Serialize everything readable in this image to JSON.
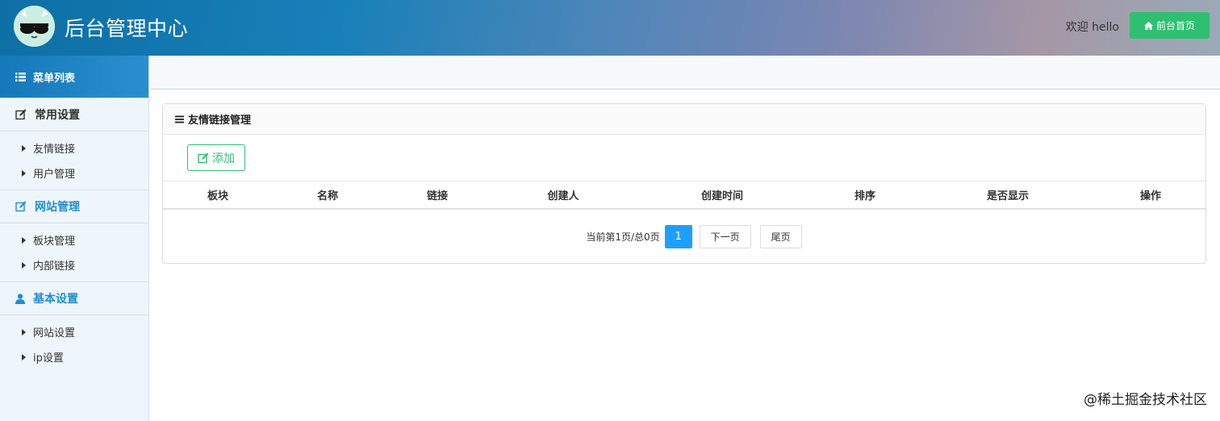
{
  "header": {
    "title": "后台管理中心",
    "welcome": "欢迎 hello",
    "home_button": "前台首页"
  },
  "sidebar": {
    "menu_title": "菜单列表",
    "groups": [
      {
        "title": "常用设置",
        "icon": "edit-icon",
        "items": [
          "友情链接",
          "用户管理"
        ]
      },
      {
        "title": "网站管理",
        "icon": "edit-icon",
        "items": [
          "板块管理",
          "内部链接"
        ]
      },
      {
        "title": "基本设置",
        "icon": "user-icon",
        "items": [
          "网站设置",
          "ip设置"
        ]
      }
    ]
  },
  "panel": {
    "title": "友情链接管理",
    "add_button": "添加",
    "columns": [
      "板块",
      "名称",
      "链接",
      "创建人",
      "创建时间",
      "排序",
      "是否显示",
      "操作"
    ]
  },
  "pagination": {
    "info": "当前第1页/总0页",
    "current": "1",
    "next": "下一页",
    "last": "尾页"
  },
  "watermark": "@稀土掘金技术社区",
  "colors": {
    "accent_green": "#2fbf71",
    "accent_blue": "#1e9fff",
    "link_blue": "#1e8fcf"
  }
}
